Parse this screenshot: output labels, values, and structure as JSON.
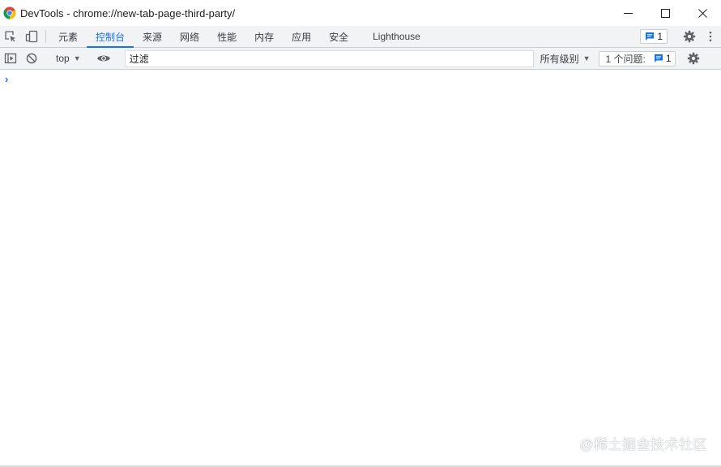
{
  "window": {
    "title": "DevTools - chrome://new-tab-page-third-party/"
  },
  "tabs": [
    {
      "label": "元素"
    },
    {
      "label": "控制台"
    },
    {
      "label": "来源"
    },
    {
      "label": "网络"
    },
    {
      "label": "性能"
    },
    {
      "label": "内存"
    },
    {
      "label": "应用"
    },
    {
      "label": "安全"
    },
    {
      "label": "Lighthouse"
    }
  ],
  "active_tab": "控制台",
  "tabbar_issues": {
    "count": "1"
  },
  "console_toolbar": {
    "context": "top",
    "filter_value": "过滤",
    "levels": "所有级别",
    "issues_label": "1 个问题:",
    "issues_count": "1"
  },
  "watermark": "@稀土掘金技术社区",
  "colors": {
    "accent": "#1a73e8",
    "toolbar_bg": "#f1f3f4",
    "border": "#cacdd1"
  },
  "icons": {
    "app": "chrome-icon",
    "minimize": "minimize-icon",
    "maximize": "maximize-icon",
    "close": "close-icon",
    "inspect": "inspect-element-icon",
    "device": "device-toolbar-icon",
    "settings": "gear-icon",
    "more": "kebab-menu-icon",
    "sidebar": "sidebar-toggle-icon",
    "clear": "clear-console-icon",
    "eye": "eye-icon",
    "issue": "issue-message-icon"
  }
}
